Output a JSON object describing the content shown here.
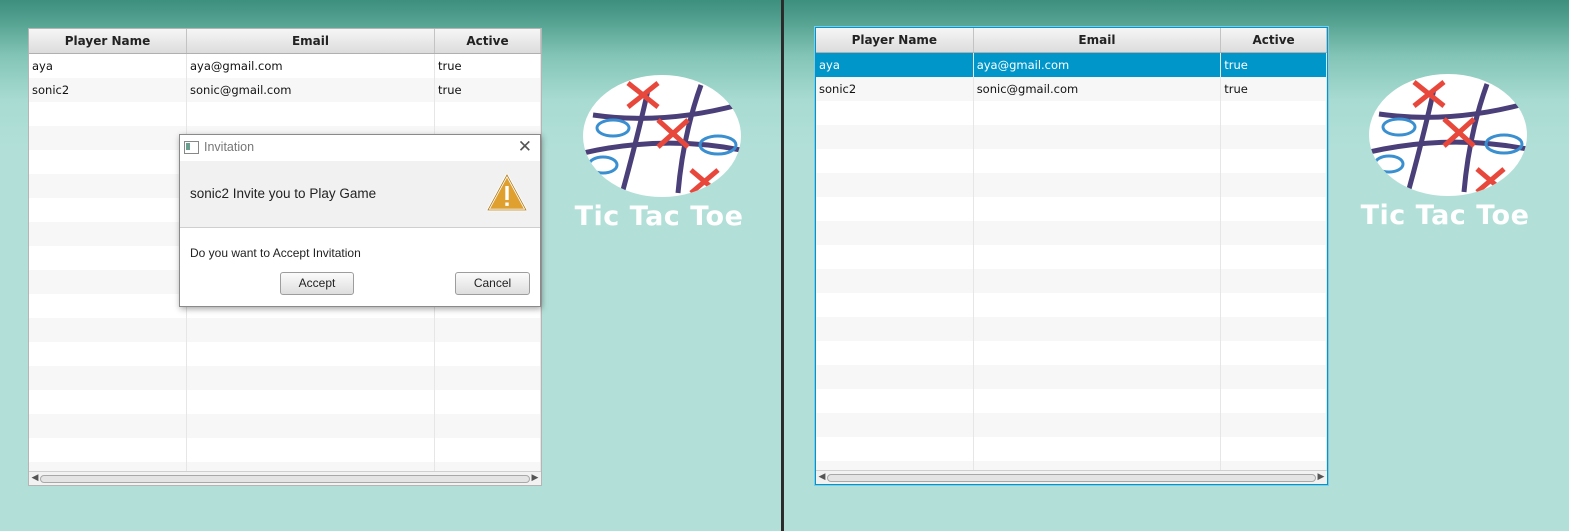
{
  "columns": [
    "Player Name",
    "Email",
    "Active"
  ],
  "left_window": {
    "rows": [
      {
        "name": "aya",
        "email": "aya@gmail.com",
        "active": "true"
      },
      {
        "name": "sonic2",
        "email": "sonic@gmail.com",
        "active": "true"
      }
    ],
    "logo_title": "Tic Tac Toe"
  },
  "right_window": {
    "rows": [
      {
        "name": "aya",
        "email": "aya@gmail.com",
        "active": "true",
        "selected": true
      },
      {
        "name": "sonic2",
        "email": "sonic@gmail.com",
        "active": "true"
      }
    ],
    "logo_title": "Tic Tac Toe"
  },
  "dialog": {
    "title": "Invitation",
    "header_text": "sonic2 Invite you to Play Game",
    "content_text": "Do you want to Accept Invitation",
    "accept_label": "Accept",
    "cancel_label": "Cancel"
  },
  "colors": {
    "selection": "#0096c9",
    "background": "#b2e0d8",
    "gradient_top": "#3d8f7e",
    "logo_red": "#e8483c",
    "logo_blue": "#3a8fd0",
    "logo_purple": "#4b3f79",
    "warning": "#e0a030"
  },
  "icons": {
    "dialog_app": "window-icon",
    "dialog_close": "close-icon",
    "dialog_warning": "warning-icon",
    "logo": "tic-tac-toe-logo-icon"
  }
}
